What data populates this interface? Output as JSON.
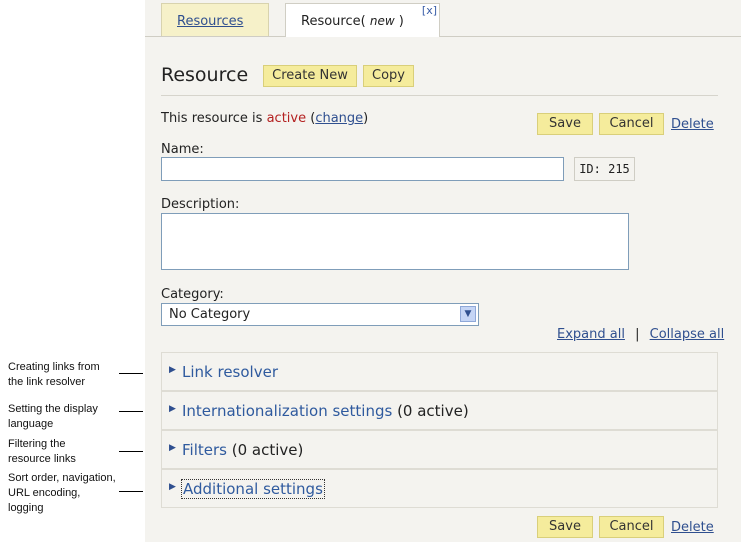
{
  "annotations": [
    {
      "lines": [
        "Creating links from",
        "the link resolver"
      ]
    },
    {
      "lines": [
        "Setting the display",
        "language"
      ]
    },
    {
      "lines": [
        "Filtering the",
        "resource links"
      ]
    },
    {
      "lines": [
        "Sort order, navigation,",
        "URL encoding,",
        "logging"
      ]
    }
  ],
  "tabs": {
    "resources_label": "Resources",
    "resource_label": "Resource(",
    "resource_new": "new",
    "resource_close_paren": ")",
    "close_label": "[x]"
  },
  "header": {
    "title": "Resource",
    "create_new": "Create New",
    "copy": "Copy"
  },
  "status": {
    "prefix": "This resource is",
    "state": "active",
    "open_paren": "(",
    "change": "change",
    "close_paren": ")"
  },
  "actions": {
    "save": "Save",
    "cancel": "Cancel",
    "delete": "Delete"
  },
  "form": {
    "name_label": "Name:",
    "name_value": "",
    "id_text": "ID: 215",
    "description_label": "Description:",
    "description_value": "",
    "category_label": "Category:",
    "category_value": "No Category"
  },
  "expand": {
    "expand_all": "Expand all",
    "separator": "|",
    "collapse_all": "Collapse all"
  },
  "sections": [
    {
      "title": "Link resolver",
      "extra": ""
    },
    {
      "title": "Internationalization settings",
      "extra": "(0 active)"
    },
    {
      "title": "Filters",
      "extra": "(0 active)"
    },
    {
      "title": "Additional settings",
      "extra": ""
    }
  ],
  "colors": {
    "button_bg": "#f5ec9c",
    "link": "#2f4f8f",
    "active_text": "#b42121",
    "panel_bg": "#f4f3ef"
  }
}
